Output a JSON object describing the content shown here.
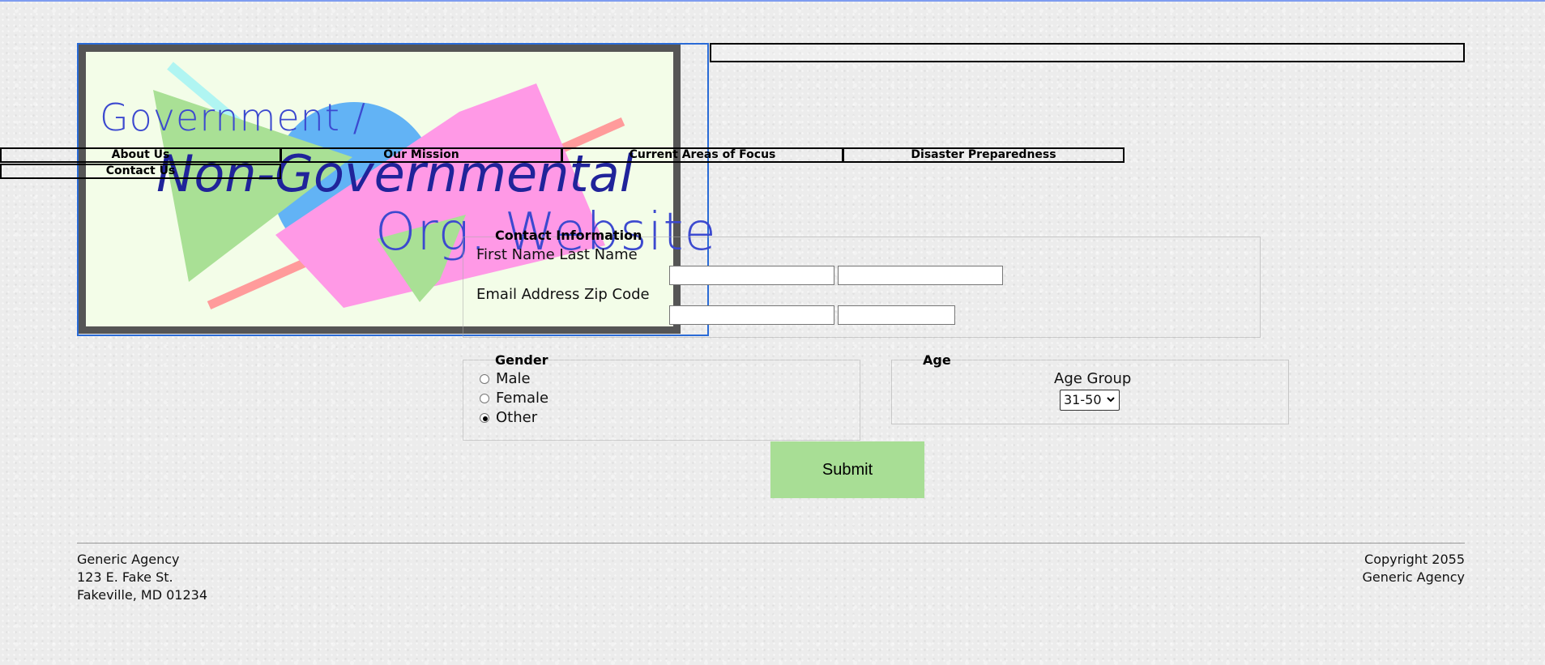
{
  "banner": {
    "title_line_1": "Government /",
    "title_line_2": "Non-Governmental",
    "title_line_3": "Org. Website"
  },
  "search": {
    "value": ""
  },
  "nav": {
    "items": [
      "About Us",
      "Our Mission",
      "Current Areas of Focus",
      "Disaster Preparedness",
      "Contact Us"
    ]
  },
  "form": {
    "contact_legend": "Contact Information",
    "row1_label": "First Name Last Name",
    "row2_label": "Email Address Zip Code",
    "first_name_value": "",
    "last_name_value": "",
    "email_value": "",
    "zip_value": "",
    "gender_legend": "Gender",
    "gender_options": [
      {
        "label": "Male",
        "checked": false
      },
      {
        "label": "Female",
        "checked": false
      },
      {
        "label": "Other",
        "checked": true
      }
    ],
    "age_legend": "Age",
    "age_group_label": "Age Group",
    "age_group_selected": "31-50",
    "submit_label": "Submit"
  },
  "footer": {
    "left": [
      "Generic Agency",
      "123 E. Fake St.",
      "Fakeville, MD 01234"
    ],
    "right": [
      "Copyright 2055",
      "Generic Agency"
    ]
  },
  "colors": {
    "banner_background": "#f3fde8",
    "banner_border": "#555555",
    "title_blue": "#3c49cf",
    "title_navy": "#20239a",
    "submit_green": "#a8de95",
    "shape_blue": "#62b3f5",
    "shape_pink": "#ff99e6",
    "shape_green": "#a9e095",
    "shape_cyan": "#b0f5f2",
    "shape_salmon": "#ff9b9b"
  }
}
